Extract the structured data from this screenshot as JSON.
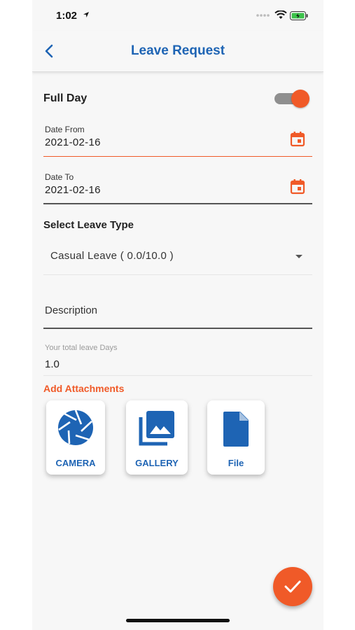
{
  "status_bar": {
    "time": "1:02"
  },
  "header": {
    "title": "Leave Request"
  },
  "full_day": {
    "label": "Full Day",
    "enabled": true
  },
  "date_from": {
    "label": "Date From",
    "value": "2021-02-16"
  },
  "date_to": {
    "label": "Date To",
    "value": "2021-02-16"
  },
  "leave_type": {
    "label": "Select Leave Type",
    "selected": "Casual Leave ( 0.0/10.0 )"
  },
  "description": {
    "placeholder": "Description"
  },
  "total_days": {
    "label": "Your total leave Days",
    "value": "1.0"
  },
  "attachments": {
    "title": "Add Attachments",
    "options": [
      {
        "label": "CAMERA",
        "icon": "camera-icon"
      },
      {
        "label": "GALLERY",
        "icon": "gallery-icon"
      },
      {
        "label": "File",
        "icon": "file-icon"
      }
    ]
  },
  "colors": {
    "accent": "#f05a28",
    "primary": "#1e64b4"
  }
}
